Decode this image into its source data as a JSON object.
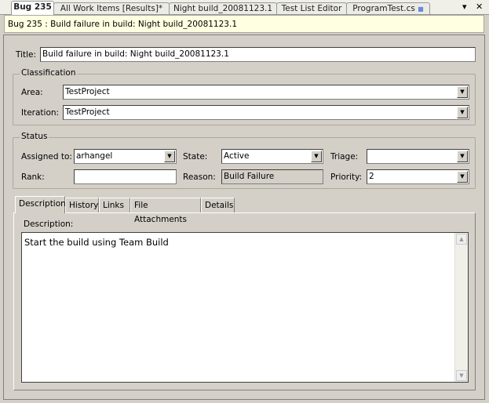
{
  "tabs": [
    {
      "label": "Bug 235",
      "active": true
    },
    {
      "label": "All Work Items [Results]*"
    },
    {
      "label": "Night build_20081123.1"
    },
    {
      "label": "Test List Editor"
    },
    {
      "label": "ProgramTest.cs"
    }
  ],
  "window_controls": {
    "menu": "▾",
    "close": "✕"
  },
  "header": "Bug 235 : Build failure in build: Night build_20081123.1",
  "title": {
    "label": "Title:",
    "value": "Build failure in build: Night build_20081123.1"
  },
  "classification": {
    "title": "Classification",
    "area_label": "Area:",
    "area": "TestProject",
    "iteration_label": "Iteration:",
    "iteration": "TestProject"
  },
  "status": {
    "title": "Status",
    "assigned_label": "Assigned to:",
    "assigned": "arhangel",
    "state_label": "State:",
    "state": "Active",
    "triage_label": "Triage:",
    "triage": "",
    "rank_label": "Rank:",
    "rank": "",
    "reason_label": "Reason:",
    "reason": "Build Failure",
    "priority_label": "Priority:",
    "priority": "2"
  },
  "form_tabs": [
    "Description",
    "History",
    "Links",
    "File Attachments",
    "Details"
  ],
  "description": {
    "label": "Description:",
    "text": "Start the build using Team Build"
  }
}
